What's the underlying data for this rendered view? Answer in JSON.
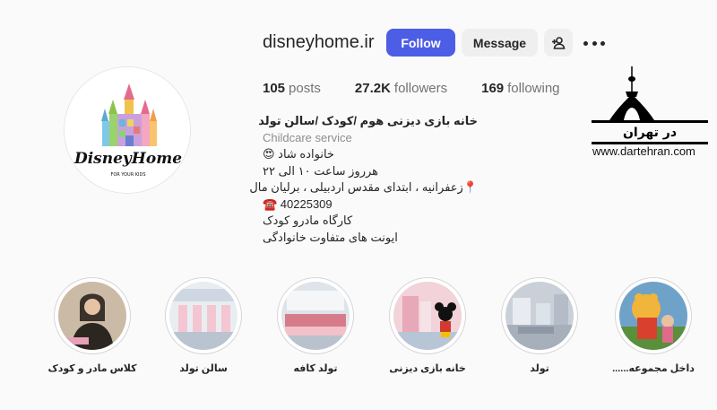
{
  "profile": {
    "username": "disneyhome.ir",
    "logo_text": "DisneyHome",
    "logo_subtext": "FOR YOUR KIDS"
  },
  "actions": {
    "follow_label": "Follow",
    "message_label": "Message",
    "add_user_icon": "person-add-icon",
    "more_icon": "more-horizontal-icon"
  },
  "stats": {
    "posts_count": "105",
    "posts_label": "posts",
    "followers_count": "27.2K",
    "followers_label": "followers",
    "following_count": "169",
    "following_label": "following"
  },
  "bio": {
    "name": "خانه بازی دیزنی هوم /کودک /سالن تولد",
    "category": "Childcare service",
    "lines": [
      "خانواده شاد 😍",
      "هرروز ساعت ۱۰ الی ۲۲",
      "📍زعفرانیه ، ابتدای مقدس اردبیلی ، برلیان مال",
      "☎️ 40225309",
      "کارگاه مادرو کودک",
      "ایونت های متفاوت خانوادگی"
    ]
  },
  "watermark": {
    "title": "در تهران",
    "url": "www.dartehran.com"
  },
  "highlights": [
    {
      "label": "داخل مجموعه......",
      "color": "#f0b53a"
    },
    {
      "label": "تولد",
      "color": "#b9c3cf"
    },
    {
      "label": "خانه بازی دیزنی",
      "color": "#e9b7c2"
    },
    {
      "label": "تولد کافه",
      "color": "#d98f9a"
    },
    {
      "label": "سالن تولد",
      "color": "#c7d0db"
    },
    {
      "label": "کلاس مادر و کودک",
      "color": "#8a7a6a"
    }
  ],
  "colors": {
    "follow_button": "#4c5de6",
    "secondary_button": "#efefef",
    "text_primary": "#262626",
    "text_secondary": "#737373",
    "background": "#fafafa"
  }
}
